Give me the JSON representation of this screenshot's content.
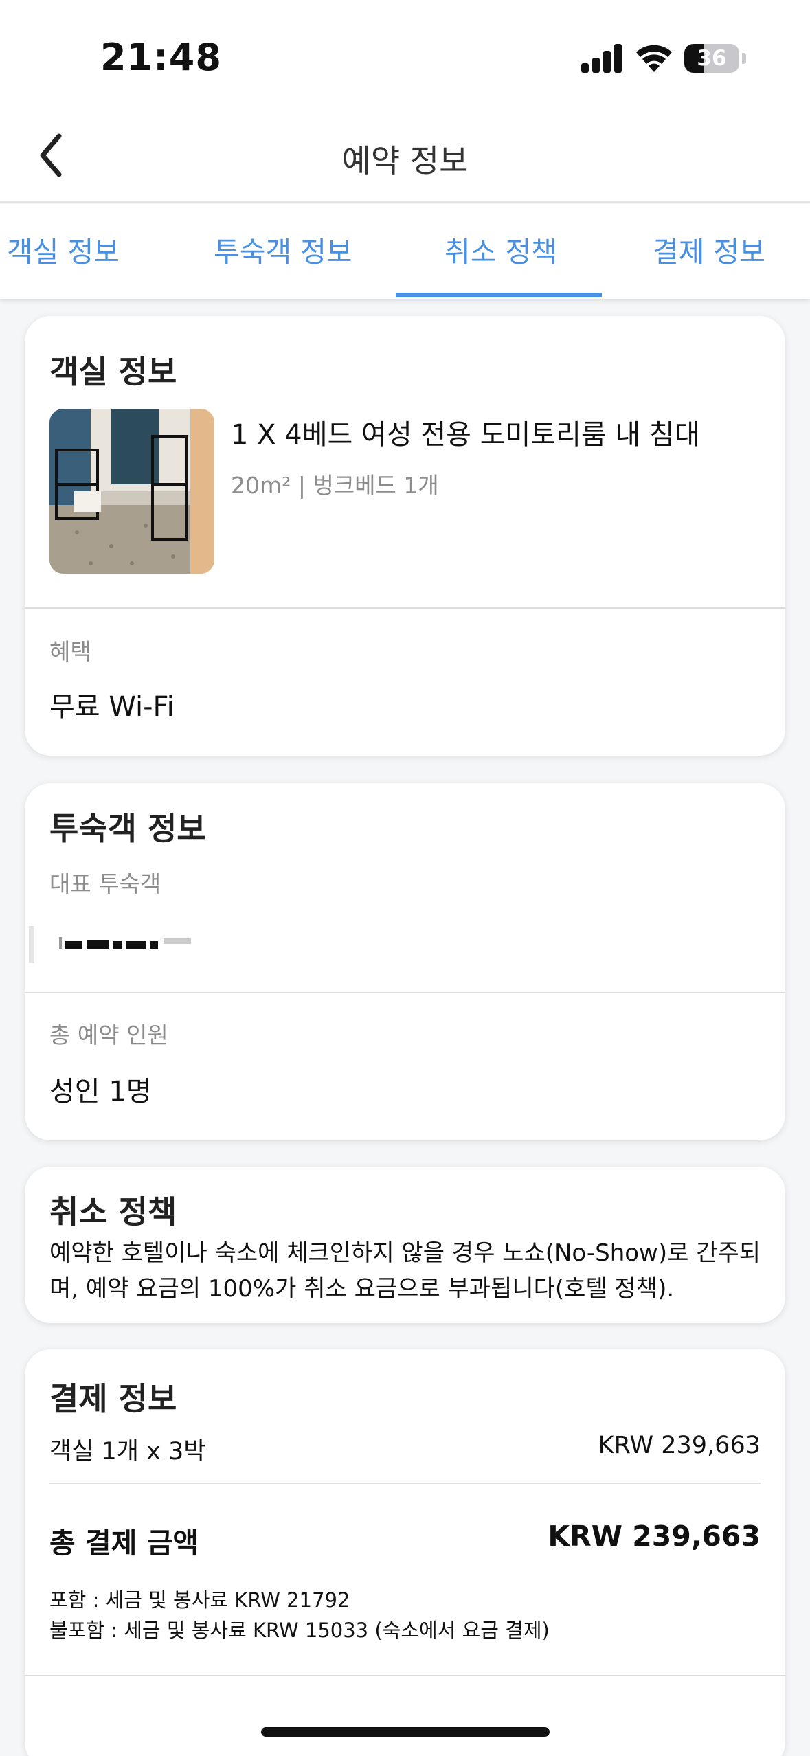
{
  "status_bar": {
    "time": "21:48",
    "battery_level": "36",
    "battery_fraction": 0.36
  },
  "header": {
    "title": "예약 정보",
    "back_icon": "chevron-left-icon"
  },
  "tabs": [
    {
      "label": "객실 정보"
    },
    {
      "label": "투숙객 정보"
    },
    {
      "label": "취소 정책",
      "active": true
    },
    {
      "label": "결제 정보"
    }
  ],
  "room": {
    "title": "객실 정보",
    "name": "1 X 4베드 여성 전용 도미토리룸 내 침대",
    "meta": "20m² | 벙크베드 1개",
    "benefit_label": "혜택",
    "benefit_value": "무료 Wi-Fi"
  },
  "guest": {
    "title": "투숙객 정보",
    "lead_label": "대표 투숙객",
    "count_label": "총 예약 인원",
    "count_value": "성인 1명"
  },
  "cancel": {
    "title": "취소 정책",
    "text": "예약한 호텔이나 숙소에 체크인하지 않을 경우 노쇼(No-Show)로 간주되며, 예약 요금의 100%가 취소 요금으로 부과됩니다(호텔 정책)."
  },
  "payment": {
    "title": "결제 정보",
    "line_label": "객실 1개 x 3박",
    "line_value": "KRW 239,663",
    "total_label": "총 결제 금액",
    "total_value": "KRW 239,663",
    "included": "포함 : 세금 및 봉사료 KRW 21792",
    "excluded": "불포함 : 세금 및 봉사료 KRW 15033 (숙소에서 요금 결제)"
  },
  "colors": {
    "accent": "#4a90e2",
    "muted": "#8c8c8c",
    "background": "#f5f6f8"
  }
}
